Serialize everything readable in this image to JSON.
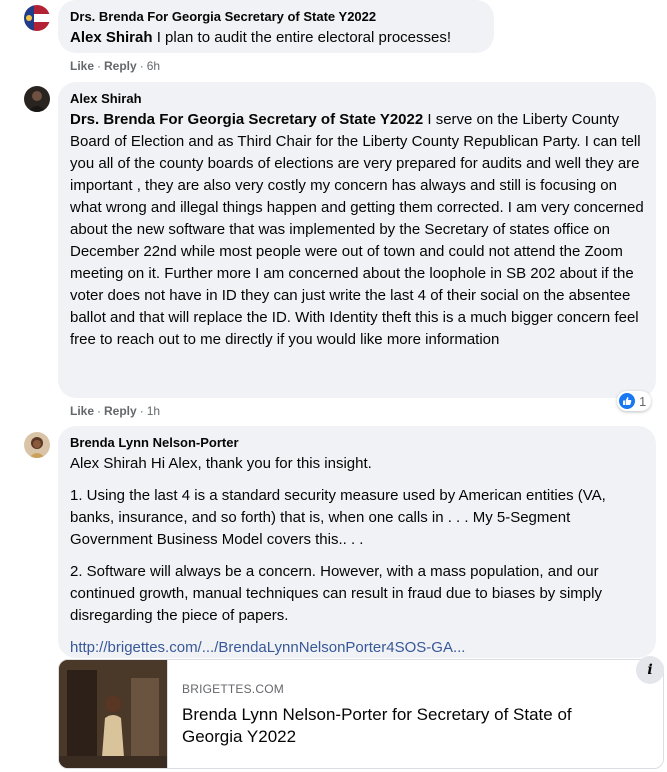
{
  "comments": [
    {
      "author": "Drs. Brenda For Georgia Secretary of State Y2022",
      "mention": "Alex Shirah",
      "text": " I plan to audit the entire electoral processes!",
      "like": "Like",
      "reply": "Reply",
      "time": "6h"
    },
    {
      "author": "Alex Shirah",
      "mention": "Drs. Brenda For Georgia Secretary of State Y2022",
      "text": " I serve on the Liberty County Board of Election and as Third Chair for the Liberty County Republican Party. I can tell you all of the county boards of elections are very prepared for audits and well they are important , they are also very costly my concern has always and still is focusing on what wrong and illegal things happen and getting them corrected. I am very concerned about the new software that was implemented by the Secretary of states office on December 22nd while most people were out of town and could not attend the Zoom meeting on it. Further more I am concerned about the loophole in SB 202 about if the voter does not have in ID they can just write the last 4 of their social on the absentee ballot and that will replace the ID. With Identity theft this is a much bigger concern feel free to reach out to me directly if you would like more information",
      "like": "Like",
      "reply": "Reply",
      "time": "1h",
      "reaction_count": "1"
    },
    {
      "author": "Brenda Lynn Nelson-Porter",
      "intro": "Alex Shirah Hi Alex, thank you for this insight.",
      "para1": "1. Using the last 4 is a standard security measure used by American entities (VA, banks, insurance, and so forth) that is, when one calls in . . . My 5-Segment Government Business Model covers this.. . .",
      "para2": "2. Software will always be a concern. However, with a mass population, and our continued growth, manual techniques can result in fraud due to biases by simply disregarding the piece of papers.",
      "link": "http://brigettes.com/.../BrendaLynnNelsonPorter4SOS-GA..."
    }
  ],
  "preview": {
    "domain": "BRIGETTES.COM",
    "title": "Brenda Lynn Nelson-Porter for Secretary of State of Georgia Y2022",
    "info": "i"
  },
  "colors": {
    "bubble": "#f0f2f5",
    "meta": "#65676b",
    "link": "#385898",
    "like_blue": "#1877f2"
  }
}
